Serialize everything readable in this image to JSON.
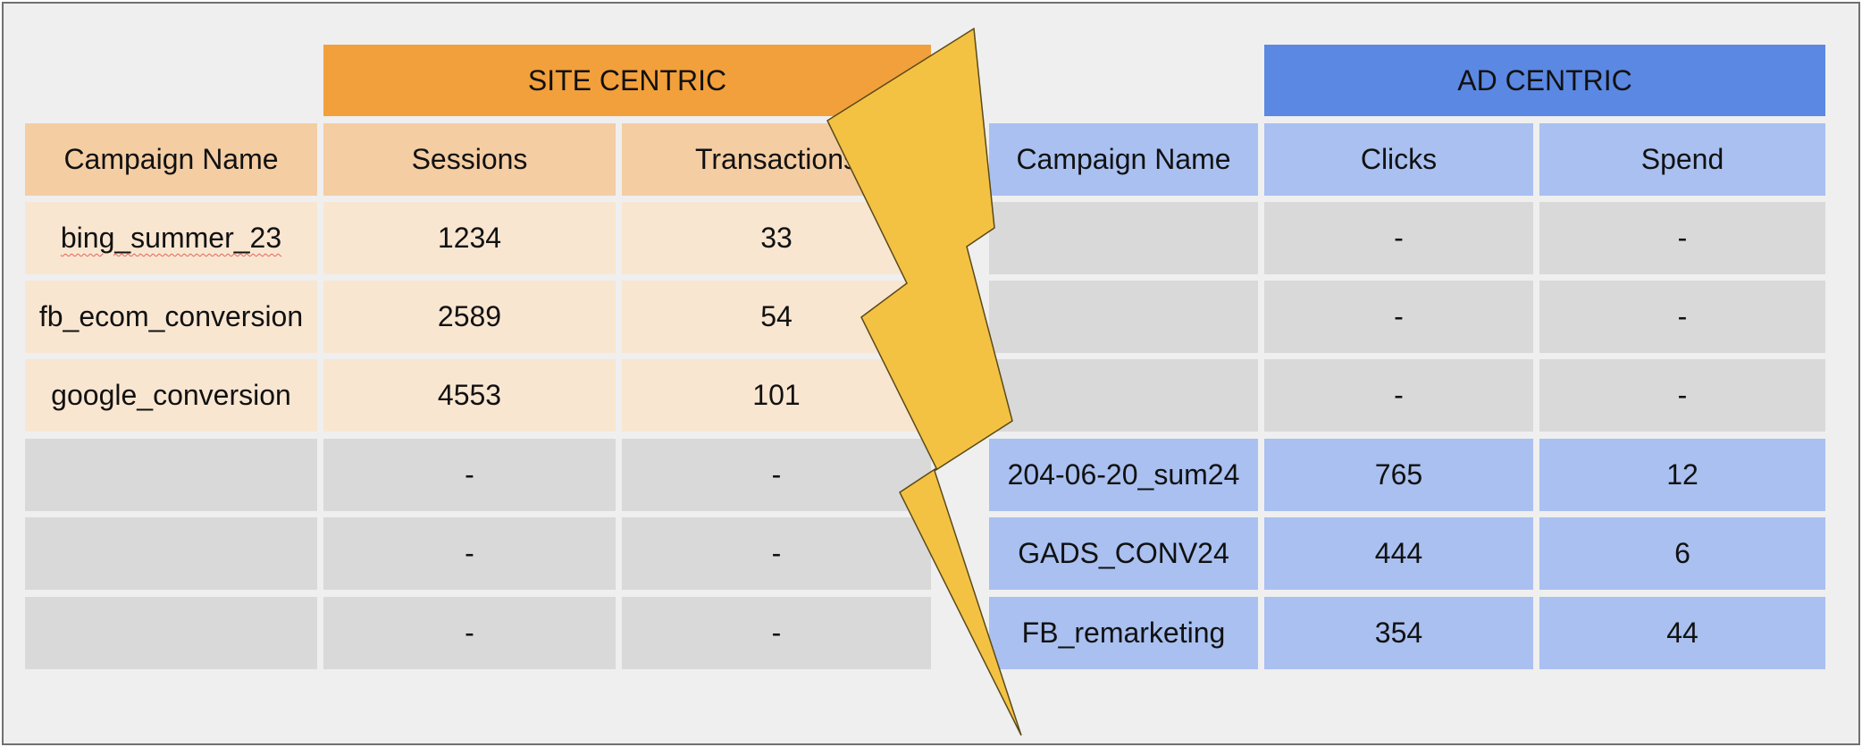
{
  "site_centric": {
    "title": "SITE CENTRIC",
    "columns": [
      "Campaign Name",
      "Sessions",
      "Transactions"
    ],
    "rows": [
      [
        "bing_summer_23",
        "1234",
        "33"
      ],
      [
        "fb_ecom_conversion",
        "2589",
        "54"
      ],
      [
        "google_conversion",
        "4553",
        "101"
      ],
      [
        "",
        "-",
        "-"
      ],
      [
        "",
        "-",
        "-"
      ],
      [
        "",
        "-",
        "-"
      ]
    ]
  },
  "ad_centric": {
    "title": "AD CENTRIC",
    "columns": [
      "Campaign Name",
      "Clicks",
      "Spend"
    ],
    "rows": [
      [
        "",
        "-",
        "-"
      ],
      [
        "",
        "-",
        "-"
      ],
      [
        "",
        "-",
        "-"
      ],
      [
        "204-06-20_sum24",
        "765",
        "12"
      ],
      [
        "GADS_CONV24",
        "444",
        "6"
      ],
      [
        "FB_remarketing",
        "354",
        "44"
      ]
    ]
  },
  "colors": {
    "site_header": "#f2a03c",
    "site_columns": "#f4cda3",
    "site_rows": "#f9e6d1",
    "ad_header": "#5b88e2",
    "ad_columns": "#a9c0f0",
    "empty_cell": "#d9d9d9",
    "lightning_bolt": "#f4c243"
  }
}
